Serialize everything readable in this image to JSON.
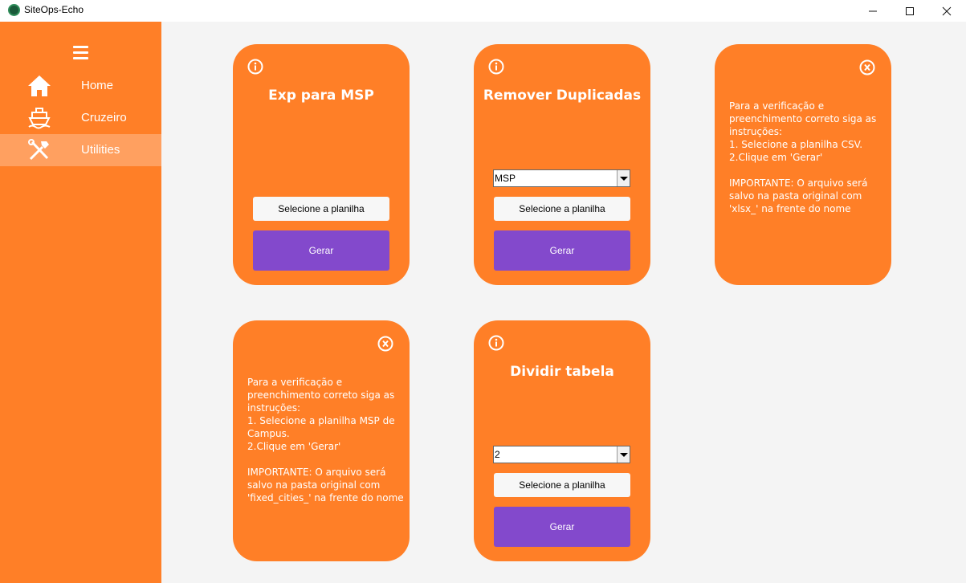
{
  "window": {
    "title": "SiteOps-Echo"
  },
  "sidebar": {
    "items": [
      {
        "label": "Home",
        "icon": "home-icon"
      },
      {
        "label": "Cruzeiro",
        "icon": "ship-icon"
      },
      {
        "label": "Utilities",
        "icon": "tools-icon",
        "active": true
      }
    ]
  },
  "cards": {
    "exp_msp": {
      "title": "Exp para MSP",
      "select_label": "Selecione a planilha",
      "gerar_label": "Gerar"
    },
    "remover": {
      "title": "Remover Duplicadas",
      "dropdown_value": "MSP",
      "select_label": "Selecione a planilha",
      "gerar_label": "Gerar"
    },
    "help_csv": {
      "lines": [
        "Para a verificação e",
        "preenchimento correto siga as",
        "instruções:",
        "1. Selecione a planilha CSV.",
        "2.Clique em 'Gerar'",
        "",
        "IMPORTANTE: O arquivo será",
        "salvo na pasta original com",
        "'xlsx_' na frente do nome"
      ]
    },
    "help_msp": {
      "lines": [
        "Para a verificação e",
        "preenchimento correto siga as",
        "instruções:",
        "1. Selecione a planilha MSP de",
        "Campus.",
        "2.Clique em 'Gerar'",
        "",
        "IMPORTANTE: O arquivo será",
        "salvo na pasta original com",
        "'fixed_cities_' na frente do nome"
      ]
    },
    "dividir": {
      "title": "Dividir tabela",
      "dropdown_value": "2",
      "select_label": "Selecione a planilha",
      "gerar_label": "Gerar"
    }
  },
  "colors": {
    "sidebar": "#ff7f27",
    "card": "#ff7f27",
    "active_nav": "#ffa060",
    "gerar_button": "#8349cc",
    "background": "#f4f4f4"
  }
}
